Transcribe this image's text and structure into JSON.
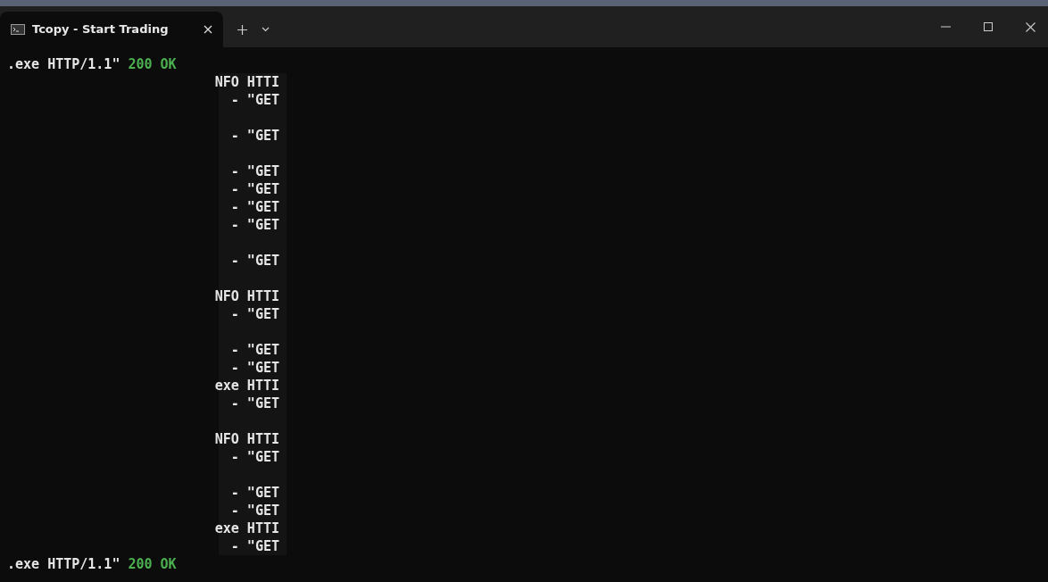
{
  "tab": {
    "title": "Tcopy - Start Trading",
    "selected": true
  },
  "lines": [
    {
      "kind": "status",
      "text": ".exe HTTP/1.1\"",
      "status": "200 OK"
    },
    {
      "kind": "column",
      "text": "NFO HTTI"
    },
    {
      "kind": "column",
      "text": "- \"GET"
    },
    {
      "kind": "blank"
    },
    {
      "kind": "column",
      "text": "- \"GET"
    },
    {
      "kind": "blank"
    },
    {
      "kind": "column",
      "text": "- \"GET"
    },
    {
      "kind": "column",
      "text": "- \"GET"
    },
    {
      "kind": "column",
      "text": "- \"GET"
    },
    {
      "kind": "column",
      "text": "- \"GET"
    },
    {
      "kind": "blank"
    },
    {
      "kind": "column",
      "text": "- \"GET"
    },
    {
      "kind": "blank"
    },
    {
      "kind": "column",
      "text": "NFO HTTI"
    },
    {
      "kind": "column",
      "text": "- \"GET"
    },
    {
      "kind": "blank"
    },
    {
      "kind": "column",
      "text": "- \"GET"
    },
    {
      "kind": "column",
      "text": "- \"GET"
    },
    {
      "kind": "column",
      "text": "exe HTTI"
    },
    {
      "kind": "column",
      "text": "- \"GET"
    },
    {
      "kind": "blank"
    },
    {
      "kind": "column",
      "text": "NFO HTTI"
    },
    {
      "kind": "column",
      "text": "- \"GET"
    },
    {
      "kind": "blank"
    },
    {
      "kind": "column",
      "text": "- \"GET"
    },
    {
      "kind": "column",
      "text": "- \"GET"
    },
    {
      "kind": "column",
      "text": "exe HTTI"
    },
    {
      "kind": "column",
      "text": "- \"GET"
    },
    {
      "kind": "status",
      "text": ".exe HTTP/1.1\"",
      "status": "200 OK"
    }
  ]
}
